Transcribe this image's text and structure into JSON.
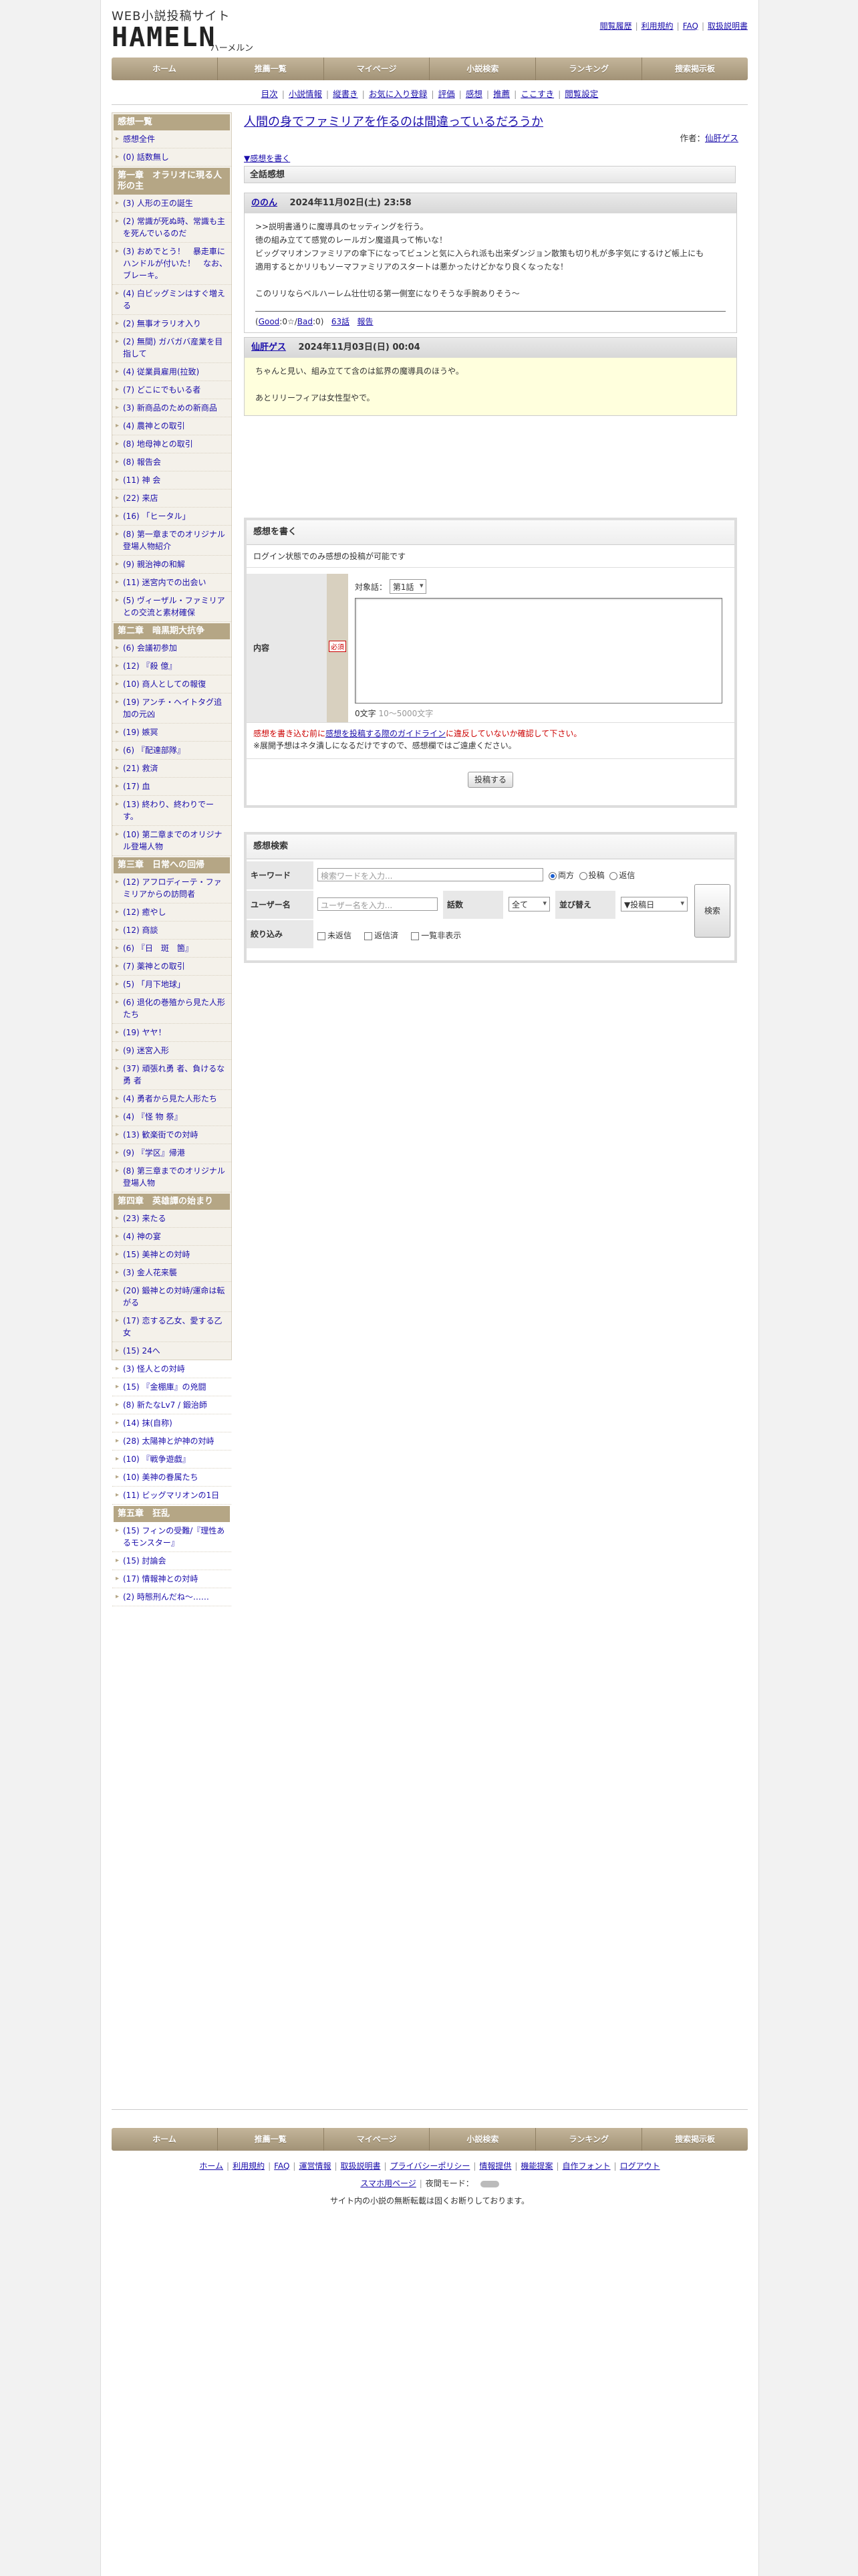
{
  "header": {
    "logo_top": "WEB小説投稿サイト",
    "logo_main": "HAMELN",
    "logo_kana": "ハーメルン",
    "links": [
      "閲覧履歴",
      "利用規約",
      "FAQ",
      "取扱説明書"
    ]
  },
  "gnav": [
    "ホーム",
    "推薦一覧",
    "マイページ",
    "小説検索",
    "ランキング",
    "捜索掲示板"
  ],
  "subnav": [
    "目次",
    "小説情報",
    "縦書き",
    "お気に入り登録",
    "評価",
    "感想",
    "推薦",
    "ここすき",
    "閲覧設定"
  ],
  "sidebar": {
    "sections": [
      {
        "head": "感想一覧",
        "items": [
          "感想全件",
          "(0) 話数無し"
        ]
      },
      {
        "head": "第一章　オラリオに現る人形の主",
        "items": [
          "(3) 人形の王の誕生",
          "(2) 常識が死ぬ時、常識も主を死んでいるのだ",
          "(3) おめでとう！　暴走車にハンドルが付いた！　なお、ブレーキ。",
          "(4) 白ビッグミンはすぐ増える",
          "(2) 無事オラリオ入り",
          "(2) 無間) ガバガバ産業を目指して",
          "(4) 従業員雇用(拉致)",
          "(7) どこにでもいる者",
          "(3) 新商品のための新商品",
          "(4) 農神との取引",
          "(8) 地母神との取引",
          "(8) 報告会",
          "(11) 神 会",
          "(22) 来店",
          "(16) 「ヒータル」",
          "(8) 第一章までのオリジナル登場人物紹介",
          "(9) 親治神の和解",
          "(11) 迷宮内での出会い",
          "(5) ヴィーザル・ファミリアとの交流と素材確保"
        ]
      },
      {
        "head": "第二章　暗黒期大抗争",
        "items": [
          "(6) 会議初参加",
          "(12) 『殺 億』",
          "(10) 商人としての報復",
          "(19) アンチ・ヘイトタグ追加の元凶",
          "(19) 嫉冥",
          "(6) 『配達部隊』",
          "(21) 救済",
          "(17) 血",
          "(13) 終わり、終わりでーす。",
          "(10) 第二章までのオリジナル登場人物"
        ]
      },
      {
        "head": "第三章　日常への回帰",
        "items": [
          "(12) アフロディーテ・ファミリアからの訪問者",
          "(12) 癒やし",
          "(12) 商談",
          "(6) 『日　斑　箇』",
          "(7) 薬神との取引",
          "(5) 「月下地球」",
          "(6) 退化の巻殖から見た人形たち",
          "(19) ヤヤ！",
          "(9) 迷宮入形",
          "(37) 頑張れ勇 者、負けるな勇 者",
          "(4) 勇者から見た人形たち",
          "(4) 『怪 物 祭』",
          "(13) 歓楽街での対峙",
          "(9) 『学区』帰港",
          "(8) 第三章までのオリジナル登場人物"
        ]
      },
      {
        "head": "第四章　英雄譚の始まり",
        "items": [
          "(23) 来たる",
          "(4) 神の宴",
          "(15) 美神との対峙",
          "(3) 金人花来襲",
          "(20) 鍛神との対峙/運命は転がる",
          "(17) 恋する乙女、愛する乙女",
          "(15) 24へ",
          "(3) 怪人との対峙",
          "(15) 『金棚庫』の兇闘",
          "(8) 新たなLv7 / 鍛治師",
          "(14) 抹(自称)",
          "(28) 太陽神と炉神の対峙",
          "(10) 『戦争遊戯』",
          "(10) 美神の眷属たち",
          "(11) ビッグマリオンの1日"
        ]
      },
      {
        "head": "第五章　狂乱",
        "items": [
          "(15) フィンの受難/『理性あるモンスター』",
          "(15) 討論会",
          "(17) 情報神との対峙",
          "(2) 時態刑んだね～……"
        ]
      }
    ]
  },
  "main": {
    "title": "人間の身でファミリアを作るのは間違っているだろうか",
    "author_label": "作者：",
    "author_name": "仙肝ゲス",
    "write_link": "▼感想を書く",
    "all_reviews_head": "全話感想",
    "reviews": [
      {
        "name": "ののん",
        "date": "2024年11月02日(土) 23:58",
        "lines": [
          ">>説明書通りに魔導具のセッティングを行う。",
          "徳の組み立てて感覚のレールガン魔道具って怖いな！",
          "ビッグマリオンファミリアの傘下になってビュンと気に入られ派も出来ダンジョン散策も切り札が多字気にするけど帳上にも",
          "適用するとかリリもソーマファミリアのスタートは悪かったけどかなり良くなったな！",
          "",
          "このリリならベルハーレム壮仕切る第一側室になりそうな手腕ありそう～"
        ],
        "footer_good": "Good",
        "footer_bad": "Bad",
        "footer_good_n": "0",
        "footer_bad_n": "0",
        "footer_ep": "63話",
        "footer_report": "報告"
      },
      {
        "name": "仙肝ゲス",
        "date": "2024年11月03日(日) 00:04",
        "lines": [
          "ちゃんと見い、組み立てて含のは鉱界の魔導具のほうや。",
          "",
          "あとリリーフィアは女性型やで。"
        ]
      }
    ],
    "write": {
      "head": "感想を書く",
      "note": "ログイン状態でのみ感想の投稿が可能です",
      "content_label": "内容",
      "required": "必須",
      "target_label": "対象話：",
      "target_value": "第1話",
      "count_text": "0文字",
      "count_range": "10～5000文字",
      "warn_pre": "感想を書き込む前に",
      "warn_link": "感想を投稿する際のガイドライン",
      "warn_post": "に違反していないか確認して下さい。",
      "warn2": "※展開予想はネタ潰しになるだけですので、感想欄ではご遠慮ください。",
      "submit": "投稿する"
    },
    "search": {
      "head": "感想検索",
      "kw_label": "キーワード",
      "kw_placeholder": "検索ワードを入力...",
      "radios": [
        "両方",
        "投稿",
        "返信"
      ],
      "user_label": "ユーザー名",
      "user_placeholder": "ユーザー名を入力...",
      "ep_label": "話数",
      "ep_value": "全て",
      "sort_label": "並び替え",
      "sort_value": "▼投稿日",
      "filter_label": "絞り込み",
      "checks": [
        "未返信",
        "返信済",
        "一覧非表示"
      ],
      "button": "検索"
    }
  },
  "footer": {
    "links": [
      "ホーム",
      "利用規約",
      "FAQ",
      "運営情報",
      "取扱説明書",
      "プライバシーポリシー",
      "情報提供",
      "機能提案",
      "自作フォント",
      "ログアウト"
    ],
    "mobile_link": "スマホ用ページ",
    "night_label": "夜間モード：",
    "copyright": "サイト内の小説の無断転載は固くお断りしております。"
  },
  "colors": {
    "accent_nav": "#b5a685",
    "link": "#1a0dab",
    "reply_bg": "#ffffdd",
    "warn": "#cc0000"
  }
}
